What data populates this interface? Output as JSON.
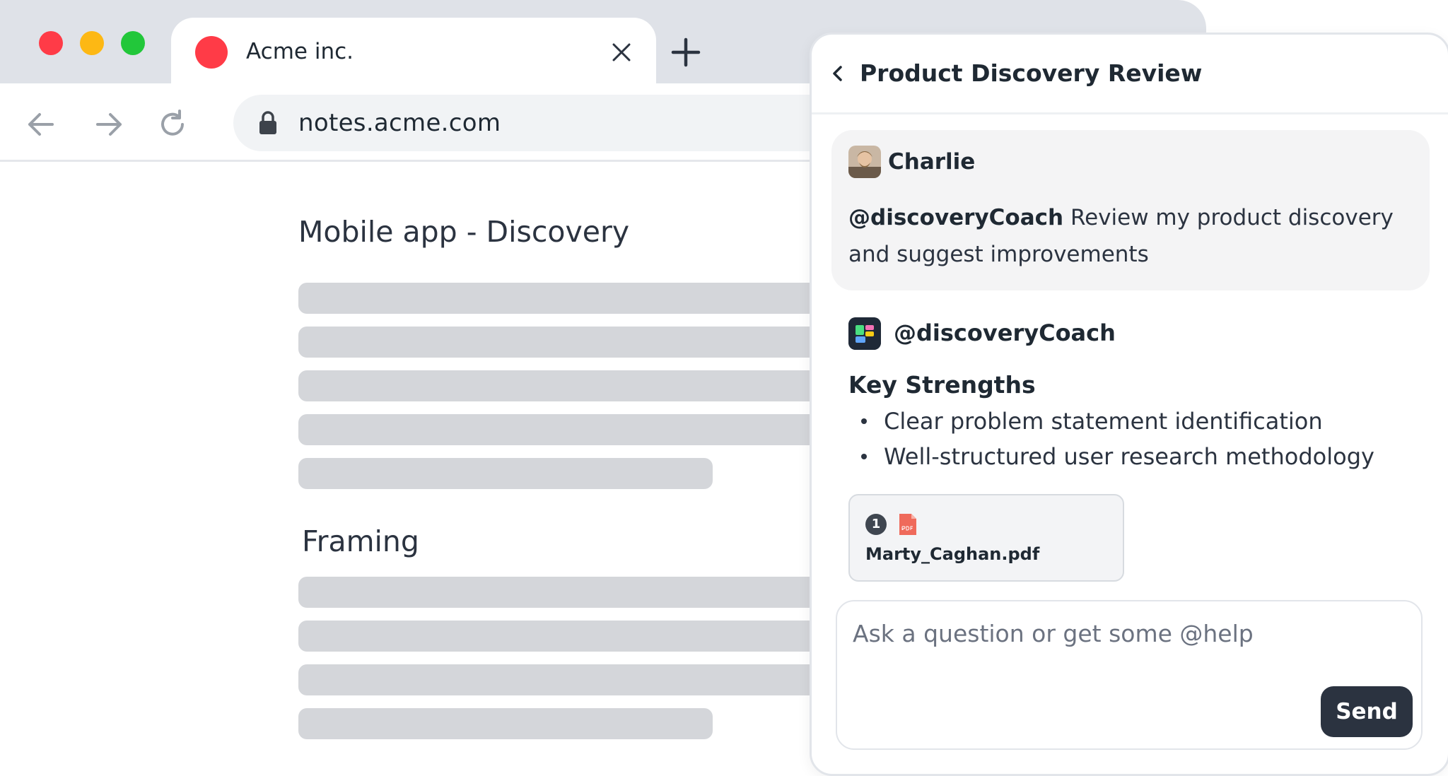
{
  "browser": {
    "tab": {
      "title": "Acme inc.",
      "favicon_color": "#ff3b47"
    },
    "url": "notes.acme.com",
    "traffic_lights": [
      "#ff3b47",
      "#fdb814",
      "#22c73a"
    ]
  },
  "document": {
    "title": "Mobile app - Discovery",
    "section_heading": "Framing"
  },
  "chat": {
    "title": "Product Discovery Review",
    "user_message": {
      "author": "Charlie",
      "mention": "@discoveryCoach",
      "text": "Review my product discovery and suggest improvements"
    },
    "bot_message": {
      "name": "@discoveryCoach",
      "heading": "Key Strengths",
      "bullets": [
        "Clear problem statement identification",
        "Well-structured user research methodology"
      ],
      "attachment": {
        "count": "1",
        "filename": "Marty_Caghan.pdf"
      }
    },
    "composer": {
      "placeholder": "Ask a question or get some @help",
      "send_label": "Send"
    }
  }
}
